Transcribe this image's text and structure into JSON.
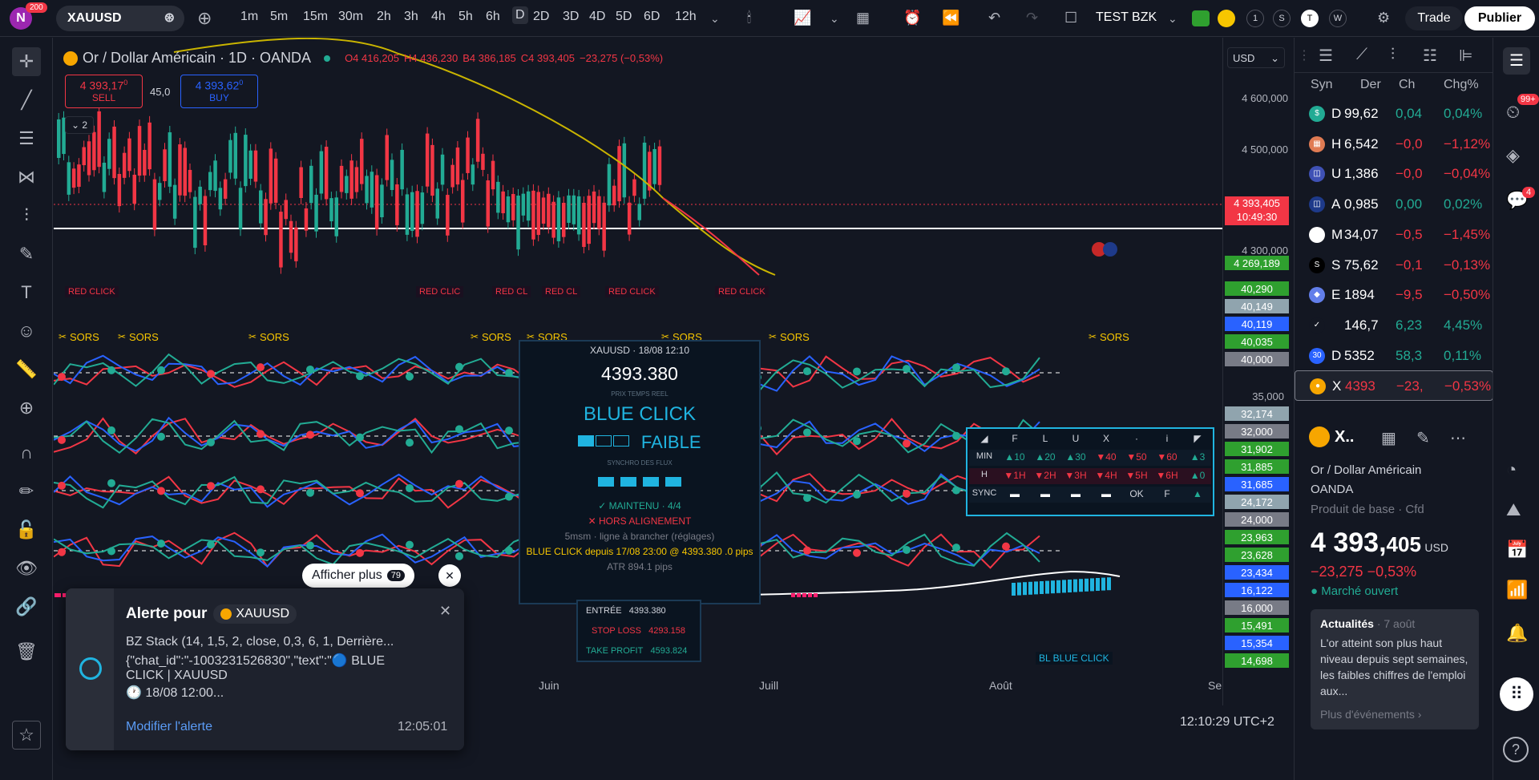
{
  "topbar": {
    "avatar_letter": "N",
    "notif_count": "200",
    "symbol": "XAUUSD",
    "timeframes": [
      "1m",
      "5m",
      "15m",
      "30m",
      "2h",
      "3h",
      "4h",
      "5h",
      "6h",
      "D",
      "2D",
      "3D",
      "4D",
      "5D",
      "6D",
      "12h"
    ],
    "active_timeframe": "D",
    "layout_name": "TEST BZK",
    "toggles": [
      "1",
      "S",
      "T",
      "W"
    ],
    "trade_label": "Trade",
    "publish_label": "Publier"
  },
  "chart": {
    "title": "Or / Dollar Américain · 1D · OANDA",
    "ohlc_o": "O4 416,205",
    "ohlc_h": "H4 436,230",
    "ohlc_b": "B4 386,185",
    "ohlc_c": "C4 393,405",
    "ohlc_change": "−23,275 (−0,53%)",
    "sell_price": "4 393,17",
    "sell_sup": "0",
    "sell_label": "SELL",
    "spread": "45,0",
    "buy_price": "4 393,62",
    "buy_sup": "0",
    "buy_label": "BUY",
    "collapse_count": "2",
    "currency": "USD",
    "price_labels": [
      "4 600,000",
      "4 500,000",
      "4 300,000"
    ],
    "price_tag_current": "4 393,405",
    "price_tag_time": "10:49:30",
    "price_tag_green": "4 269,189",
    "osc_labels": [
      {
        "v": "40,290",
        "c": "#2fa02f"
      },
      {
        "v": "40,149",
        "c": "#90a4ae"
      },
      {
        "v": "40,119",
        "c": "#2962ff"
      },
      {
        "v": "40,035",
        "c": "#2fa02f"
      },
      {
        "v": "40,000",
        "c": "#787b86"
      },
      {
        "v": "35,000",
        "c": "none"
      },
      {
        "v": "32,174",
        "c": "#90a4ae"
      },
      {
        "v": "32,000",
        "c": "#787b86"
      },
      {
        "v": "31,902",
        "c": "#2fa02f"
      },
      {
        "v": "31,885",
        "c": "#2fa02f"
      },
      {
        "v": "31,685",
        "c": "#2962ff"
      },
      {
        "v": "24,172",
        "c": "#90a4ae"
      },
      {
        "v": "24,000",
        "c": "#787b86"
      },
      {
        "v": "23,963",
        "c": "#2fa02f"
      },
      {
        "v": "23,628",
        "c": "#2fa02f"
      },
      {
        "v": "23,434",
        "c": "#2962ff"
      },
      {
        "v": "16,122",
        "c": "#2962ff"
      },
      {
        "v": "16,000",
        "c": "#787b86"
      },
      {
        "v": "15,491",
        "c": "#2fa02f"
      },
      {
        "v": "15,354",
        "c": "#2962ff"
      },
      {
        "v": "14,698",
        "c": "#2fa02f"
      }
    ],
    "red_click_labels": [
      "RED CLICK",
      "RED CLIC",
      "RED CL",
      "RED CL",
      "RED CLICK",
      "RED CLICK"
    ],
    "sors_label": "SORS",
    "blue_click_bottom": "BL   BLUE CLICK",
    "months": [
      "Juin",
      "Juill",
      "Août",
      "Sep"
    ],
    "clock": "12:10:29 UTC+2",
    "show_more": "Afficher plus",
    "show_more_count": "79"
  },
  "popup": {
    "header": "XAUUSD  ·  18/08  12:10",
    "price": "4393.380",
    "price_caption": "PRIX TEMPS REEL",
    "signal": "BLUE CLICK",
    "strength": "FAIBLE",
    "sync_caption": "SYNCHRO  DES FLUX",
    "maintenu": "✓ MAINTENU  ·  4/4",
    "hors": "✕ HORS ALIGNEMENT",
    "tf_line": "5msm  ·  ligne à brancher (réglages)",
    "since": "BLUE CLICK depuis 17/08 23:00 @ 4393.380   .0 pips",
    "atr": "ATR 894.1 pips",
    "entry_label": "ENTRÉE",
    "entry_val": "4393.380",
    "sl_label": "STOP LOSS",
    "sl_val": "4293.158",
    "tp_label": "TAKE PROFIT",
    "tp_val": "4593.824"
  },
  "signal_table": {
    "header": [
      "◢",
      "F",
      "L",
      "U",
      "X",
      "·",
      "i",
      "◤"
    ],
    "rows": [
      {
        "label": "MIN",
        "cells": [
          "▲10",
          "▲20",
          "▲30",
          "▼40",
          "▼50",
          "▼60",
          "▲3"
        ]
      },
      {
        "label": "H",
        "cells": [
          "▼1H",
          "▼2H",
          "▼3H",
          "▼4H",
          "▼5H",
          "▼6H",
          "▲0"
        ]
      },
      {
        "label": "SYNC",
        "cells": [
          "▬",
          "▬",
          "▬",
          "▬",
          "OK",
          "F",
          "▲"
        ]
      }
    ]
  },
  "alert": {
    "title": "Alerte pour",
    "symbol": "XAUUSD",
    "line1": "BZ Stack (14, 1,5, 2, close, 0,3, 6, 1, Derrière...",
    "line2": "{\"chat_id\":\"-1003231526830\",\"text\":\"🔵 BLUE",
    "line3": "CLICK  |  XAUUSD",
    "line4": "🕐 18/08 12:00...",
    "edit": "Modifier l'alerte",
    "time": "12:05:01"
  },
  "watchlist": {
    "headers": [
      "Syn",
      "Der",
      "Ch",
      "Chg%"
    ],
    "rows": [
      {
        "sym": "D",
        "last": "99,62",
        "ch": "0,04",
        "chp": "0,04%",
        "up": true,
        "icon": "#22ab94",
        "glyph": "$"
      },
      {
        "sym": "H",
        "last": "6,542",
        "ch": "−0,0",
        "chp": "−1,12%",
        "up": false,
        "icon": "#e07b53",
        "glyph": "▦"
      },
      {
        "sym": "U",
        "last": "1,386",
        "ch": "−0,0",
        "chp": "−0,04%",
        "up": false,
        "icon": "#3f51b5",
        "glyph": "◫"
      },
      {
        "sym": "A",
        "last": "0,985",
        "ch": "0,00",
        "chp": "0,02%",
        "up": true,
        "icon": "#1e3a8a",
        "glyph": "◫"
      },
      {
        "sym": "M",
        "last": "34,07",
        "ch": "−0,5",
        "chp": "−1,45%",
        "up": false,
        "icon": "#ffffff",
        "glyph": "M"
      },
      {
        "sym": "S",
        "last": "75,62",
        "ch": "−0,1",
        "chp": "−0,13%",
        "up": false,
        "icon": "#000000",
        "glyph": "S"
      },
      {
        "sym": "E",
        "last": "1894",
        "ch": "−9,5",
        "chp": "−0,50%",
        "up": false,
        "icon": "#627eea",
        "glyph": "◆"
      },
      {
        "sym": "",
        "last": "146,7",
        "ch": "6,23",
        "chp": "4,45%",
        "up": true,
        "icon": "#131722",
        "glyph": "✓"
      },
      {
        "sym": "D",
        "last": "5352",
        "ch": "58,3",
        "chp": "0,11%",
        "up": true,
        "icon": "#2962ff",
        "glyph": "30"
      },
      {
        "sym": "X",
        "last": "4393",
        "ch": "−23,",
        "chp": "−0,53%",
        "up": false,
        "icon": "#f7a600",
        "glyph": "●"
      }
    ]
  },
  "details": {
    "symbol_short": "X..",
    "name": "Or / Dollar Américain",
    "exchange": "OANDA",
    "category": "Produit de base · Cfd",
    "price_main": "4 393,",
    "price_small": "405",
    "currency": "USD",
    "change": "−23,275  −0,53%",
    "market_status": "Marché ouvert",
    "news_tag": "Actualités",
    "news_date": "· 7 août",
    "news_text": "L'or atteint son plus haut niveau depuis sept semaines, les faibles chiffres de l'emploi aux...",
    "news_more": "Plus d'événements ›"
  },
  "rtools": {
    "badge_99": "99+",
    "badge_4": "4"
  }
}
